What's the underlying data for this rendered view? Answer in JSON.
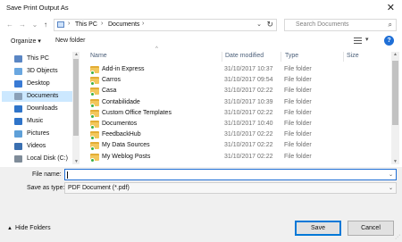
{
  "window": {
    "title": "Save Print Output As",
    "close_icon": "close-icon"
  },
  "address": {
    "crumbs": [
      "This PC",
      "Documents"
    ],
    "search_placeholder": "Search Documents"
  },
  "toolbar": {
    "organize": "Organize ▾",
    "new_folder": "New folder"
  },
  "nav": {
    "items": [
      {
        "label": "This PC",
        "icon": "computer-icon",
        "color": "#5a86c4"
      },
      {
        "label": "3D Objects",
        "icon": "cube-icon",
        "color": "#6aa7e0"
      },
      {
        "label": "Desktop",
        "icon": "desktop-icon",
        "color": "#3a7bd5"
      },
      {
        "label": "Documents",
        "icon": "document-icon",
        "color": "#8aa0b8"
      },
      {
        "label": "Downloads",
        "icon": "download-icon",
        "color": "#2f74c9"
      },
      {
        "label": "Music",
        "icon": "music-icon",
        "color": "#2f74c9"
      },
      {
        "label": "Pictures",
        "icon": "pictures-icon",
        "color": "#5fa0d8"
      },
      {
        "label": "Videos",
        "icon": "video-icon",
        "color": "#3a6fb0"
      },
      {
        "label": "Local Disk (C:)",
        "icon": "drive-icon",
        "color": "#7f8c99"
      }
    ],
    "selected_index": 3
  },
  "list": {
    "columns": {
      "name": "Name",
      "date": "Date modified",
      "type": "Type",
      "size": "Size"
    },
    "rows": [
      {
        "name": "Add-in Express",
        "date": "31/10/2017 10:37",
        "type": "File folder"
      },
      {
        "name": "Carros",
        "date": "31/10/2017 09:54",
        "type": "File folder"
      },
      {
        "name": "Casa",
        "date": "31/10/2017 02:22",
        "type": "File folder"
      },
      {
        "name": "Contabilidade",
        "date": "31/10/2017 10:39",
        "type": "File folder"
      },
      {
        "name": "Custom Office Templates",
        "date": "31/10/2017 02:22",
        "type": "File folder"
      },
      {
        "name": "Documentos",
        "date": "31/10/2017 10:40",
        "type": "File folder"
      },
      {
        "name": "FeedbackHub",
        "date": "31/10/2017 02:22",
        "type": "File folder"
      },
      {
        "name": "My Data Sources",
        "date": "31/10/2017 02:22",
        "type": "File folder"
      },
      {
        "name": "My Weblog Posts",
        "date": "31/10/2017 02:22",
        "type": "File folder"
      }
    ]
  },
  "form": {
    "file_name_label": "File name:",
    "file_name_value": "",
    "save_as_type_label": "Save as type:",
    "save_as_type_value": "PDF Document (*.pdf)"
  },
  "footer": {
    "hide_folders": "Hide Folders",
    "save": "Save",
    "cancel": "Cancel"
  },
  "colors": {
    "accent": "#0078d7",
    "selection": "#cce8ff",
    "folder": "#f2c75c",
    "sync_badge": "#3cb043"
  }
}
